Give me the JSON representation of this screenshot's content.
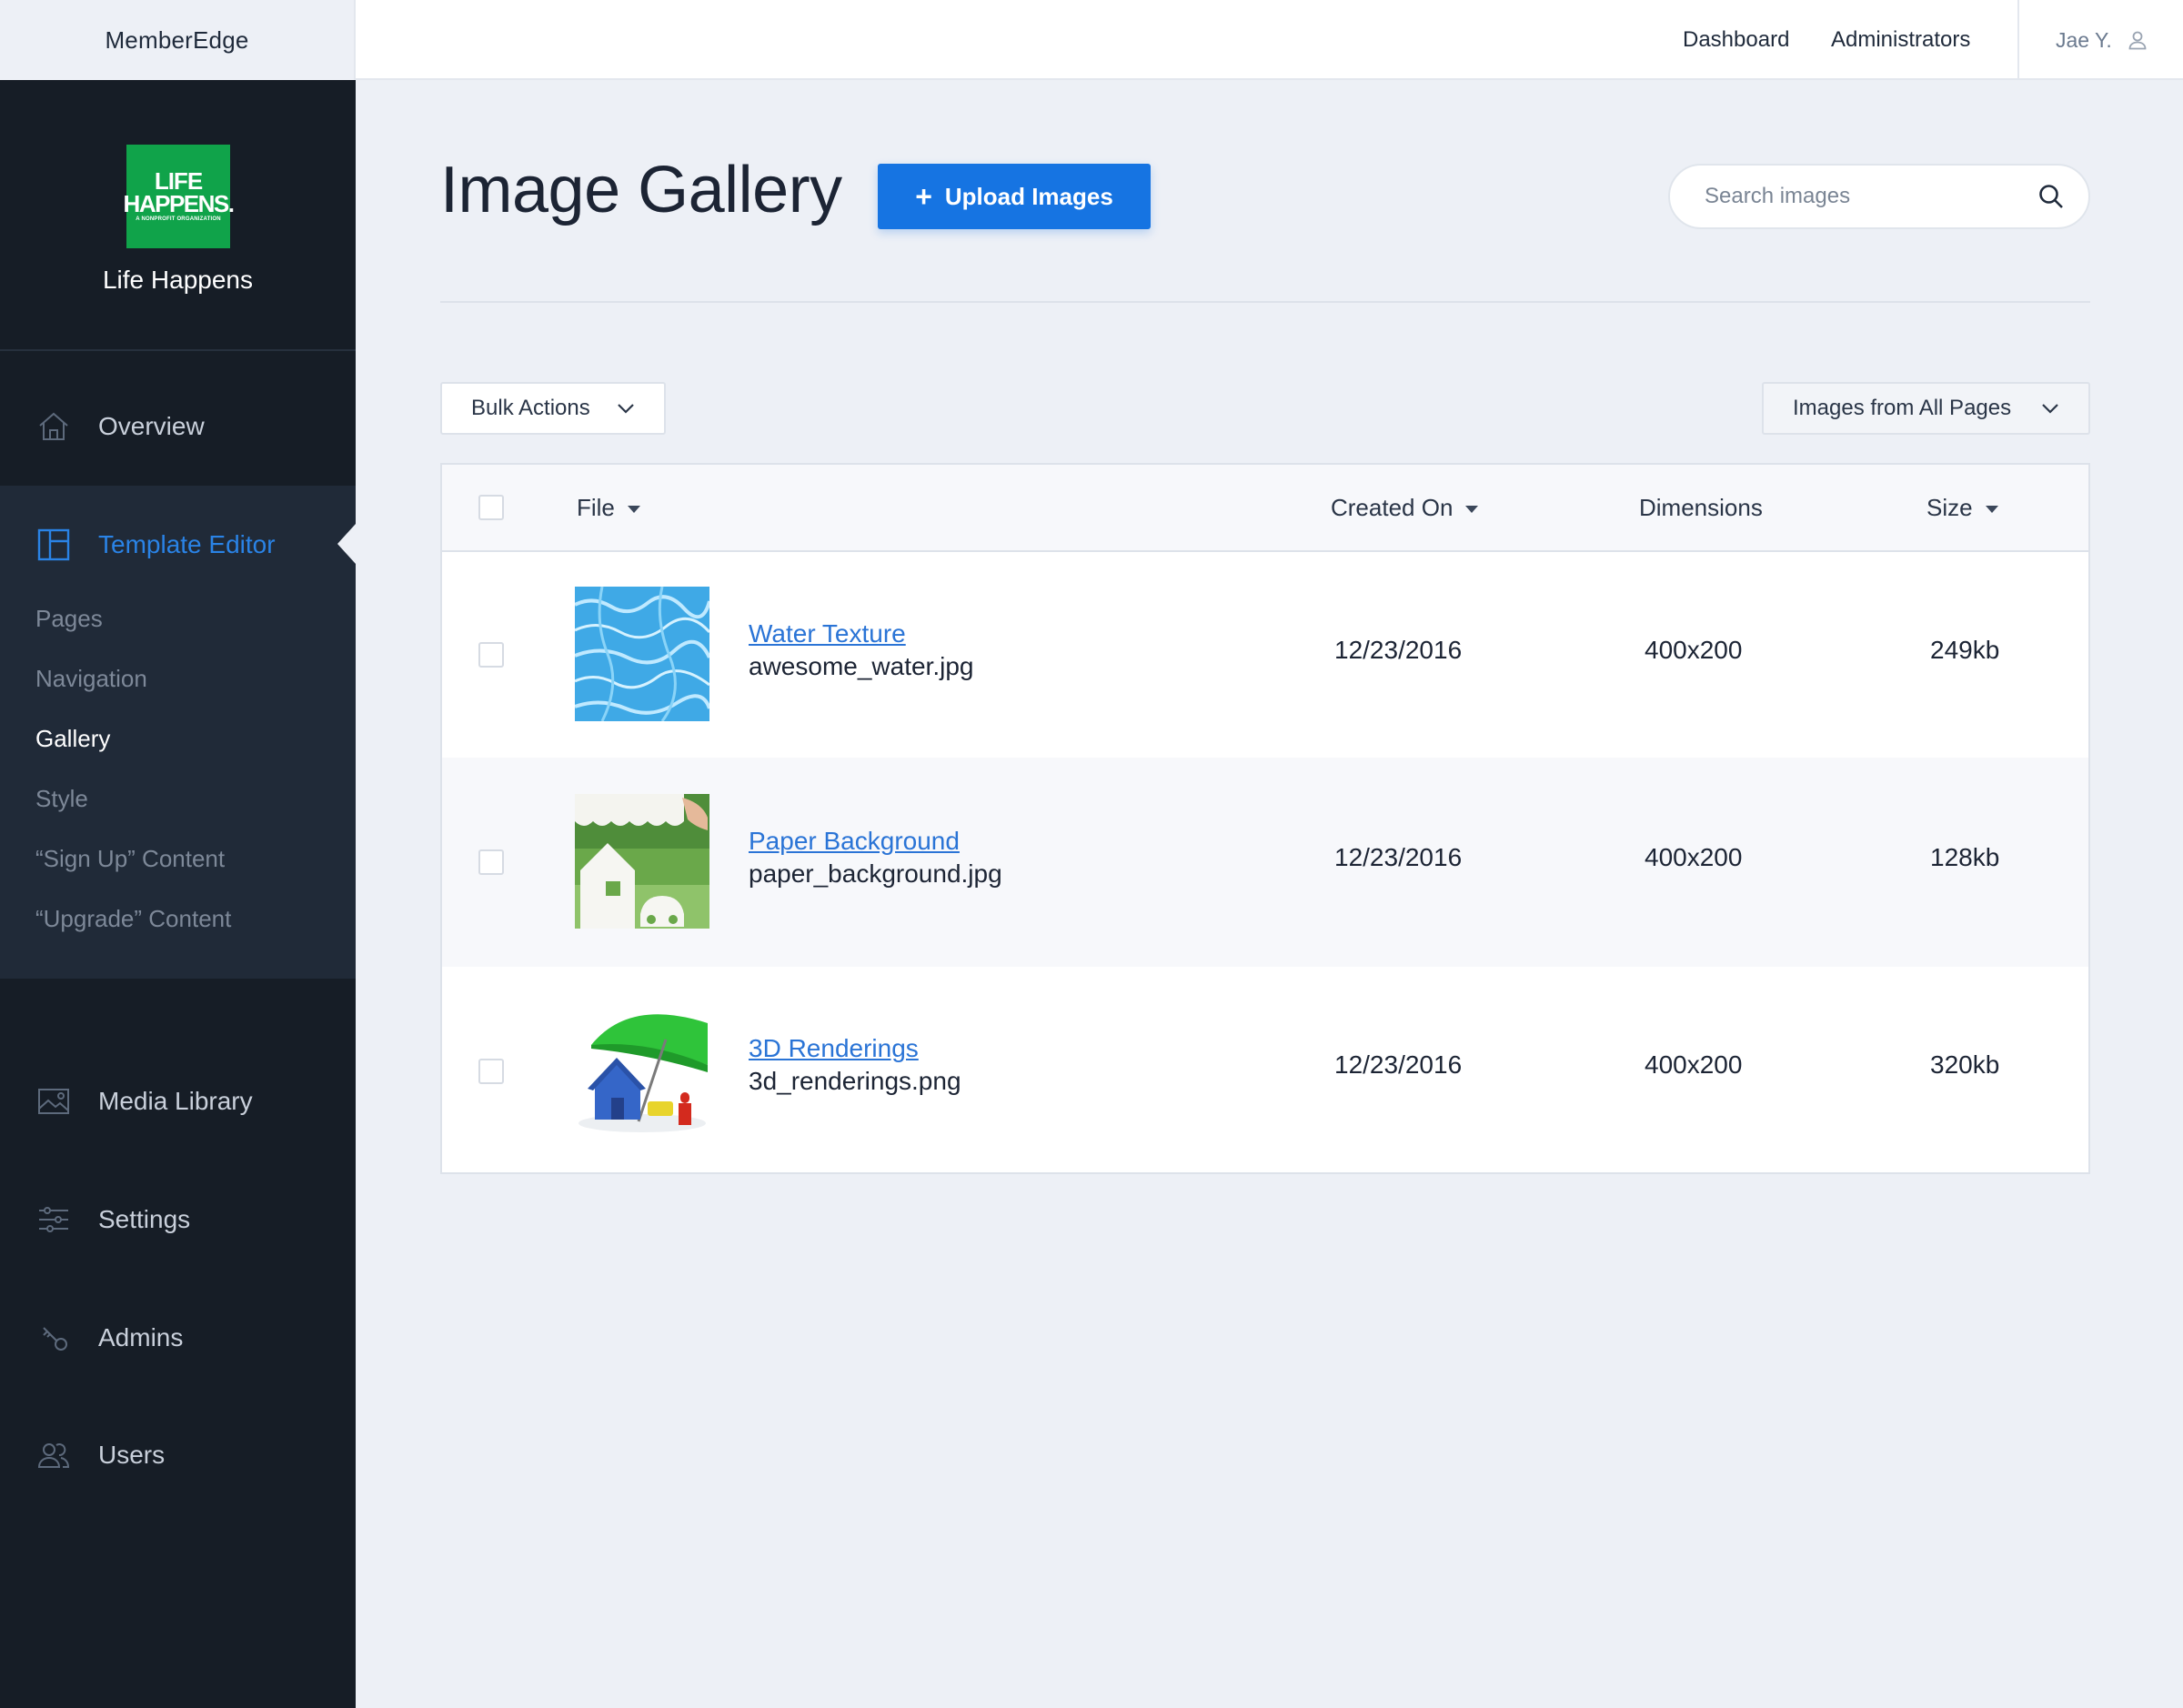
{
  "app": {
    "name": "MemberEdge"
  },
  "topnav": {
    "dashboard": "Dashboard",
    "administrators": "Administrators",
    "user_name": "Jae Y."
  },
  "org": {
    "name": "Life Happens",
    "logo_line1": "LIFE",
    "logo_line2": "HAPPENS.",
    "logo_tagline": "A NONPROFIT ORGANIZATION",
    "logo_color": "#10a34a"
  },
  "sidebar": {
    "overview": "Overview",
    "template_editor": "Template Editor",
    "subitems": [
      "Pages",
      "Navigation",
      "Gallery",
      "Style",
      "“Sign Up” Content",
      "“Upgrade” Content"
    ],
    "active_subitem": "Gallery",
    "media_library": "Media Library",
    "settings": "Settings",
    "admins": "Admins",
    "users": "Users",
    "accent": "#2a83e6"
  },
  "page": {
    "title": "Image Gallery",
    "upload_label": "Upload Images",
    "search_placeholder": "Search images"
  },
  "filters": {
    "bulk_actions": "Bulk Actions",
    "scope": "Images from All Pages"
  },
  "table": {
    "headers": {
      "file": "File",
      "created_on": "Created On",
      "dimensions": "Dimensions",
      "size": "Size"
    },
    "rows": [
      {
        "title": "Water Texture",
        "filename": "awesome_water.jpg",
        "created": "12/23/2016",
        "dimensions": "400x200",
        "size": "249kb"
      },
      {
        "title": "Paper Background",
        "filename": "paper_background.jpg",
        "created": "12/23/2016",
        "dimensions": "400x200",
        "size": "128kb"
      },
      {
        "title": "3D Renderings",
        "filename": "3d_renderings.png",
        "created": "12/23/2016",
        "dimensions": "400x200",
        "size": "320kb"
      }
    ]
  }
}
